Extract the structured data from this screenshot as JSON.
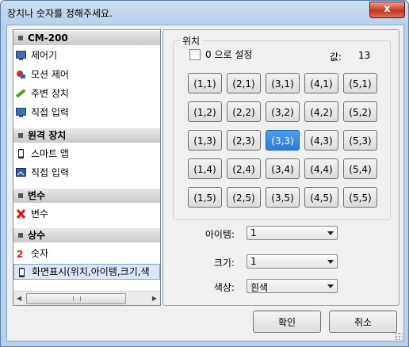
{
  "window": {
    "title": "장치나 숫자를 정해주세요.",
    "close_label": "x"
  },
  "tree": {
    "categories": [
      {
        "label": "CM-200",
        "items": [
          {
            "label": "제어기",
            "icon": "monitor-icon"
          },
          {
            "label": "모션 제어",
            "icon": "motion-icon"
          },
          {
            "label": "주변 장치",
            "icon": "peripheral-icon"
          },
          {
            "label": "직접 입력",
            "icon": "monitor-icon"
          }
        ]
      },
      {
        "label": "원격 장치",
        "items": [
          {
            "label": "스마트 앱",
            "icon": "phone-icon"
          },
          {
            "label": "직접 입력",
            "icon": "screen-icon"
          }
        ]
      },
      {
        "label": "변수",
        "items": [
          {
            "label": "변수",
            "icon": "variable-x-icon"
          }
        ]
      },
      {
        "label": "상수",
        "items": [
          {
            "label": "숫자",
            "icon": "number-icon"
          },
          {
            "label": "화면표시(위치,아이템,크기,색",
            "icon": "phone-icon",
            "selected": true
          }
        ]
      }
    ]
  },
  "position_group": {
    "label": "위치",
    "zero_checkbox_label": "0 으로 설정",
    "zero_checked": false,
    "value_label": "값:",
    "value": "13",
    "grid": [
      [
        "(1,1)",
        "(2,1)",
        "(3,1)",
        "(4,1)",
        "(5,1)"
      ],
      [
        "(1,2)",
        "(2,2)",
        "(3,2)",
        "(4,2)",
        "(5,2)"
      ],
      [
        "(1,3)",
        "(2,3)",
        "(3,3)",
        "(4,3)",
        "(5,3)"
      ],
      [
        "(1,4)",
        "(2,4)",
        "(3,4)",
        "(4,4)",
        "(5,4)"
      ],
      [
        "(1,5)",
        "(2,5)",
        "(3,5)",
        "(4,5)",
        "(5,5)"
      ]
    ],
    "selected": "(3,3)"
  },
  "fields": {
    "item": {
      "label": "아이템:",
      "value": "1"
    },
    "size": {
      "label": "크기:",
      "value": "1"
    },
    "color": {
      "label": "색상:",
      "value": "흰색"
    }
  },
  "buttons": {
    "ok": "확인",
    "cancel": "취소"
  },
  "colors": {
    "selected_cell": "#3a8ae3",
    "title_bar": "#b8d1ea"
  }
}
